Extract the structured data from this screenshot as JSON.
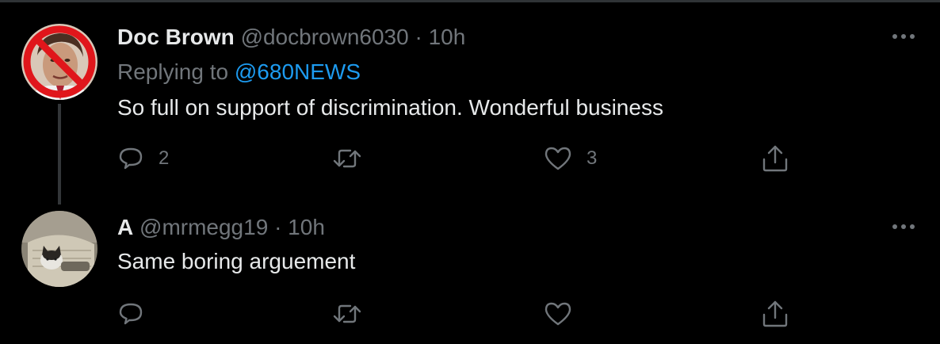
{
  "colors": {
    "background": "#000000",
    "text": "#e7e9ea",
    "muted": "#71767b",
    "link": "#1d9bf0",
    "thread_line": "#333639"
  },
  "tweets": [
    {
      "display_name": "Doc Brown",
      "handle": "@docbrown6030",
      "separator": "·",
      "time": "10h",
      "replying_prefix": "Replying to",
      "replying_to": "@680NEWS",
      "text": "So full on support of discrimination. Wonderful business",
      "reply_count": "2",
      "retweet_count": "",
      "like_count": "3",
      "avatar_icon": "prohibited-sign-over-face"
    },
    {
      "display_name": "A",
      "handle": "@mrmegg19",
      "separator": "·",
      "time": "10h",
      "text": "Same boring arguement",
      "reply_count": "",
      "retweet_count": "",
      "like_count": "",
      "avatar_icon": "cat-photo"
    }
  ]
}
